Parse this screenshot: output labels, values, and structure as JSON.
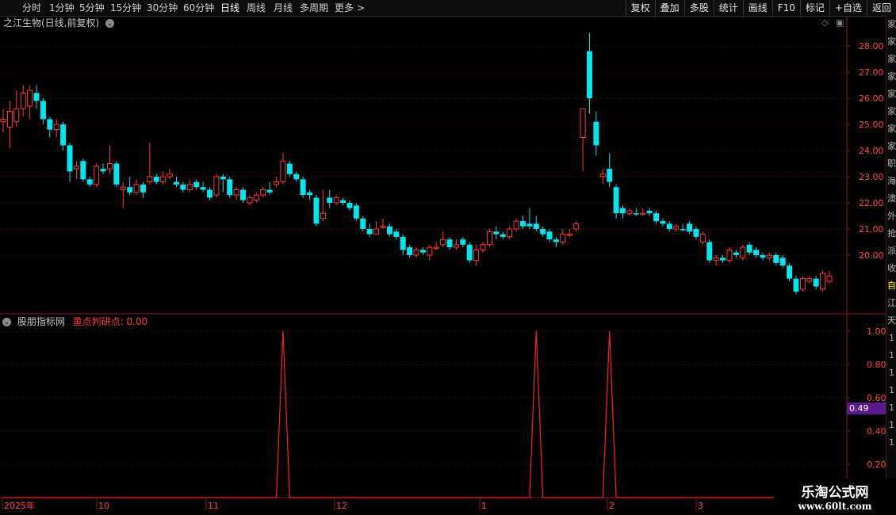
{
  "toolbar": {
    "periods": [
      "分时",
      "1分钟",
      "5分钟",
      "15分钟",
      "30分钟",
      "60分钟",
      "日线",
      "周线",
      "月线",
      "多周期",
      "更多"
    ],
    "active_period": "日线",
    "more_arrow": ">",
    "right_buttons": [
      "复权",
      "叠加",
      "多股",
      "统计",
      "画线",
      "F10",
      "标记",
      "+自选",
      "返回"
    ]
  },
  "main_chart": {
    "title": "之江生物(日线,前复权)",
    "price_axis_labels": [
      "28.00",
      "27.00",
      "26.00",
      "25.00",
      "24.00",
      "23.00",
      "22.00",
      "21.00",
      "20.00"
    ]
  },
  "indicator": {
    "name": "股朋指标网",
    "line_label": "重点判研点: 0.00",
    "axis_labels": [
      "1.00",
      "0.80",
      "0.60",
      "0.40",
      "0.20"
    ],
    "cursor_value": "0.49"
  },
  "date_axis": {
    "labels": [
      "2025年",
      "10",
      "11",
      "12",
      "1",
      "2",
      "3"
    ]
  },
  "right_strip": [
    "家",
    "家",
    "家",
    "家",
    "家",
    "家",
    "家",
    "家",
    "职",
    "海",
    "澳",
    "外",
    "抢",
    "派",
    "收",
    "自",
    "江",
    "天",
    "1",
    "1",
    "1",
    "1",
    "1",
    "1",
    "1"
  ],
  "watermark": {
    "line1": "乐淘公式网",
    "line2": "www.60lt.com"
  },
  "colors": {
    "up": "#ff3b3b",
    "down": "#00e5ee",
    "grid": "#5a1414",
    "axis_text": "#ff4a4a",
    "cursor_box": "#5a1a8a"
  },
  "chart_data": {
    "type": "candlestick",
    "price_range": [
      18.9,
      28.6
    ],
    "candles": [
      {
        "o": 25.1,
        "c": 25.2,
        "h": 25.6,
        "l": 24.7,
        "up": true
      },
      {
        "o": 24.9,
        "c": 25.5,
        "h": 25.9,
        "l": 24.1,
        "up": true
      },
      {
        "o": 25.1,
        "c": 25.6,
        "h": 26.3,
        "l": 24.9,
        "up": true
      },
      {
        "o": 25.6,
        "c": 26.2,
        "h": 26.5,
        "l": 25.3,
        "up": true
      },
      {
        "o": 25.7,
        "c": 26.3,
        "h": 26.5,
        "l": 25.2,
        "up": true
      },
      {
        "o": 26.2,
        "c": 25.9,
        "h": 26.5,
        "l": 25.6,
        "up": false
      },
      {
        "o": 25.9,
        "c": 25.2,
        "h": 26.0,
        "l": 25.0,
        "up": false
      },
      {
        "o": 25.2,
        "c": 24.8,
        "h": 25.3,
        "l": 24.5,
        "up": false
      },
      {
        "o": 24.8,
        "c": 25.0,
        "h": 25.2,
        "l": 24.5,
        "up": true
      },
      {
        "o": 25.0,
        "c": 24.2,
        "h": 25.1,
        "l": 24.0,
        "up": false
      },
      {
        "o": 24.2,
        "c": 23.2,
        "h": 24.3,
        "l": 22.8,
        "up": false
      },
      {
        "o": 23.3,
        "c": 23.4,
        "h": 23.6,
        "l": 22.9,
        "up": true
      },
      {
        "o": 23.6,
        "c": 22.9,
        "h": 23.7,
        "l": 22.8,
        "up": false
      },
      {
        "o": 22.9,
        "c": 22.7,
        "h": 23.0,
        "l": 22.6,
        "up": false
      },
      {
        "o": 22.7,
        "c": 23.4,
        "h": 23.5,
        "l": 22.6,
        "up": true
      },
      {
        "o": 23.3,
        "c": 23.2,
        "h": 23.5,
        "l": 23.1,
        "up": false
      },
      {
        "o": 23.3,
        "c": 23.5,
        "h": 24.2,
        "l": 23.1,
        "up": true
      },
      {
        "o": 23.5,
        "c": 22.7,
        "h": 23.6,
        "l": 22.6,
        "up": false
      },
      {
        "o": 22.5,
        "c": 22.6,
        "h": 22.8,
        "l": 21.8,
        "up": true
      },
      {
        "o": 22.6,
        "c": 22.4,
        "h": 23.0,
        "l": 22.3,
        "up": false
      },
      {
        "o": 22.4,
        "c": 22.7,
        "h": 22.9,
        "l": 22.3,
        "up": true
      },
      {
        "o": 22.7,
        "c": 22.4,
        "h": 22.8,
        "l": 22.2,
        "up": false
      },
      {
        "o": 22.8,
        "c": 23.0,
        "h": 24.3,
        "l": 22.7,
        "up": true
      },
      {
        "o": 23.0,
        "c": 22.8,
        "h": 23.1,
        "l": 22.7,
        "up": false
      },
      {
        "o": 22.8,
        "c": 23.0,
        "h": 23.2,
        "l": 22.7,
        "up": true
      },
      {
        "o": 23.0,
        "c": 23.1,
        "h": 23.3,
        "l": 22.9,
        "up": true
      },
      {
        "o": 22.8,
        "c": 22.7,
        "h": 23.0,
        "l": 22.6,
        "up": false
      },
      {
        "o": 22.7,
        "c": 22.5,
        "h": 22.8,
        "l": 22.4,
        "up": false
      },
      {
        "o": 22.5,
        "c": 22.7,
        "h": 22.9,
        "l": 22.4,
        "up": true
      },
      {
        "o": 22.8,
        "c": 22.6,
        "h": 22.9,
        "l": 22.5,
        "up": false
      },
      {
        "o": 22.6,
        "c": 22.5,
        "h": 22.8,
        "l": 22.4,
        "up": false
      },
      {
        "o": 22.5,
        "c": 22.2,
        "h": 22.6,
        "l": 22.1,
        "up": false
      },
      {
        "o": 22.3,
        "c": 23.0,
        "h": 23.1,
        "l": 22.2,
        "up": true
      },
      {
        "o": 23.0,
        "c": 22.9,
        "h": 23.1,
        "l": 22.4,
        "up": false
      },
      {
        "o": 22.9,
        "c": 22.3,
        "h": 23.0,
        "l": 22.2,
        "up": false
      },
      {
        "o": 22.3,
        "c": 22.5,
        "h": 22.6,
        "l": 22.1,
        "up": true
      },
      {
        "o": 22.5,
        "c": 22.1,
        "h": 22.6,
        "l": 22.0,
        "up": false
      },
      {
        "o": 22.0,
        "c": 22.2,
        "h": 22.3,
        "l": 21.9,
        "up": true
      },
      {
        "o": 22.1,
        "c": 22.3,
        "h": 22.4,
        "l": 22.0,
        "up": true
      },
      {
        "o": 22.3,
        "c": 22.5,
        "h": 22.6,
        "l": 22.2,
        "up": true
      },
      {
        "o": 22.5,
        "c": 22.4,
        "h": 22.8,
        "l": 22.3,
        "up": false
      },
      {
        "o": 22.7,
        "c": 22.8,
        "h": 23.0,
        "l": 22.6,
        "up": true
      },
      {
        "o": 22.8,
        "c": 23.6,
        "h": 23.9,
        "l": 22.7,
        "up": true
      },
      {
        "o": 23.5,
        "c": 23.1,
        "h": 23.6,
        "l": 23.0,
        "up": false
      },
      {
        "o": 23.1,
        "c": 22.9,
        "h": 23.2,
        "l": 22.8,
        "up": false
      },
      {
        "o": 22.9,
        "c": 22.3,
        "h": 23.0,
        "l": 22.2,
        "up": false
      },
      {
        "o": 22.4,
        "c": 22.3,
        "h": 22.5,
        "l": 22.1,
        "up": false
      },
      {
        "o": 22.2,
        "c": 21.2,
        "h": 22.3,
        "l": 21.1,
        "up": false
      },
      {
        "o": 21.4,
        "c": 21.6,
        "h": 22.5,
        "l": 21.3,
        "up": true
      },
      {
        "o": 22.2,
        "c": 22.0,
        "h": 22.5,
        "l": 21.8,
        "up": false
      },
      {
        "o": 22.0,
        "c": 22.2,
        "h": 22.3,
        "l": 21.9,
        "up": true
      },
      {
        "o": 22.1,
        "c": 22.0,
        "h": 22.2,
        "l": 21.9,
        "up": false
      },
      {
        "o": 22.0,
        "c": 21.8,
        "h": 22.1,
        "l": 21.7,
        "up": false
      },
      {
        "o": 21.9,
        "c": 21.4,
        "h": 22.0,
        "l": 21.3,
        "up": false
      },
      {
        "o": 21.4,
        "c": 21.0,
        "h": 21.5,
        "l": 20.9,
        "up": false
      },
      {
        "o": 21.0,
        "c": 20.8,
        "h": 21.2,
        "l": 20.7,
        "up": false
      },
      {
        "o": 20.8,
        "c": 21.0,
        "h": 21.3,
        "l": 20.8,
        "up": true
      },
      {
        "o": 21.1,
        "c": 21.1,
        "h": 21.4,
        "l": 21.0,
        "up": true
      },
      {
        "o": 21.1,
        "c": 20.8,
        "h": 21.2,
        "l": 20.7,
        "up": false
      },
      {
        "o": 20.9,
        "c": 20.7,
        "h": 21.0,
        "l": 20.6,
        "up": false
      },
      {
        "o": 20.7,
        "c": 20.2,
        "h": 20.8,
        "l": 20.0,
        "up": false
      },
      {
        "o": 20.3,
        "c": 20.0,
        "h": 20.4,
        "l": 19.9,
        "up": false
      },
      {
        "o": 20.0,
        "c": 20.2,
        "h": 20.3,
        "l": 19.9,
        "up": true
      },
      {
        "o": 20.2,
        "c": 20.1,
        "h": 20.3,
        "l": 20.0,
        "up": false
      },
      {
        "o": 20.0,
        "c": 20.3,
        "h": 20.4,
        "l": 19.8,
        "up": true
      },
      {
        "o": 20.3,
        "c": 20.3,
        "h": 20.5,
        "l": 20.2,
        "up": true
      },
      {
        "o": 20.4,
        "c": 20.6,
        "h": 20.9,
        "l": 20.3,
        "up": true
      },
      {
        "o": 20.6,
        "c": 20.3,
        "h": 20.7,
        "l": 20.2,
        "up": false
      },
      {
        "o": 20.3,
        "c": 20.4,
        "h": 20.6,
        "l": 20.2,
        "up": true
      },
      {
        "o": 20.6,
        "c": 20.4,
        "h": 20.7,
        "l": 20.3,
        "up": false
      },
      {
        "o": 20.4,
        "c": 19.8,
        "h": 20.5,
        "l": 19.7,
        "up": false
      },
      {
        "o": 19.8,
        "c": 20.2,
        "h": 20.4,
        "l": 19.6,
        "up": true
      },
      {
        "o": 20.2,
        "c": 20.4,
        "h": 20.5,
        "l": 20.1,
        "up": true
      },
      {
        "o": 20.4,
        "c": 20.9,
        "h": 21.0,
        "l": 20.3,
        "up": true
      },
      {
        "o": 20.9,
        "c": 20.8,
        "h": 21.1,
        "l": 20.6,
        "up": false
      },
      {
        "o": 20.8,
        "c": 20.7,
        "h": 20.9,
        "l": 20.6,
        "up": false
      },
      {
        "o": 20.7,
        "c": 21.0,
        "h": 21.1,
        "l": 20.6,
        "up": true
      },
      {
        "o": 21.0,
        "c": 21.3,
        "h": 21.4,
        "l": 20.9,
        "up": true
      },
      {
        "o": 21.3,
        "c": 21.1,
        "h": 21.5,
        "l": 21.0,
        "up": false
      },
      {
        "o": 21.2,
        "c": 21.1,
        "h": 21.8,
        "l": 21.0,
        "up": false
      },
      {
        "o": 21.2,
        "c": 21.0,
        "h": 21.5,
        "l": 20.9,
        "up": false
      },
      {
        "o": 21.0,
        "c": 20.8,
        "h": 21.1,
        "l": 20.7,
        "up": false
      },
      {
        "o": 20.9,
        "c": 20.6,
        "h": 21.0,
        "l": 20.5,
        "up": false
      },
      {
        "o": 20.6,
        "c": 20.5,
        "h": 20.7,
        "l": 20.3,
        "up": false
      },
      {
        "o": 20.5,
        "c": 20.8,
        "h": 21.0,
        "l": 20.4,
        "up": true
      },
      {
        "o": 20.8,
        "c": 20.8,
        "h": 21.0,
        "l": 20.7,
        "up": true
      },
      {
        "o": 21.0,
        "c": 21.2,
        "h": 21.3,
        "l": 20.9,
        "up": true
      },
      {
        "o": 25.6,
        "c": 24.5,
        "h": 25.6,
        "l": 23.2,
        "up": true
      },
      {
        "o": 26.0,
        "c": 27.8,
        "h": 28.5,
        "l": 25.4,
        "up": false
      },
      {
        "o": 25.1,
        "c": 24.2,
        "h": 25.5,
        "l": 23.8,
        "up": false
      },
      {
        "o": 23.0,
        "c": 23.1,
        "h": 23.3,
        "l": 22.7,
        "up": true
      },
      {
        "o": 23.3,
        "c": 22.8,
        "h": 23.9,
        "l": 22.6,
        "up": false
      },
      {
        "o": 22.6,
        "c": 21.6,
        "h": 22.7,
        "l": 21.4,
        "up": false
      },
      {
        "o": 21.8,
        "c": 21.6,
        "h": 21.9,
        "l": 21.4,
        "up": false
      },
      {
        "o": 21.6,
        "c": 21.7,
        "h": 21.8,
        "l": 21.5,
        "up": true
      },
      {
        "o": 21.6,
        "c": 21.6,
        "h": 21.8,
        "l": 21.5,
        "up": false
      },
      {
        "o": 21.6,
        "c": 21.6,
        "h": 21.8,
        "l": 21.5,
        "up": true
      },
      {
        "o": 21.7,
        "c": 21.6,
        "h": 21.8,
        "l": 21.5,
        "up": false
      },
      {
        "o": 21.6,
        "c": 21.3,
        "h": 21.7,
        "l": 21.2,
        "up": false
      },
      {
        "o": 21.3,
        "c": 21.2,
        "h": 21.4,
        "l": 21.1,
        "up": false
      },
      {
        "o": 21.2,
        "c": 21.0,
        "h": 21.3,
        "l": 20.9,
        "up": false
      },
      {
        "o": 21.0,
        "c": 21.1,
        "h": 21.2,
        "l": 20.9,
        "up": true
      },
      {
        "o": 21.0,
        "c": 21.0,
        "h": 21.2,
        "l": 20.9,
        "up": false
      },
      {
        "o": 21.2,
        "c": 20.9,
        "h": 21.3,
        "l": 20.8,
        "up": false
      },
      {
        "o": 21.0,
        "c": 20.7,
        "h": 21.1,
        "l": 20.6,
        "up": false
      },
      {
        "o": 20.8,
        "c": 20.5,
        "h": 20.9,
        "l": 20.4,
        "up": true
      },
      {
        "o": 20.5,
        "c": 19.8,
        "h": 20.6,
        "l": 19.7,
        "up": false
      },
      {
        "o": 19.8,
        "c": 19.9,
        "h": 20.0,
        "l": 19.6,
        "up": true
      },
      {
        "o": 19.9,
        "c": 19.8,
        "h": 20.0,
        "l": 19.7,
        "up": false
      },
      {
        "o": 19.8,
        "c": 20.2,
        "h": 20.3,
        "l": 19.7,
        "up": true
      },
      {
        "o": 20.1,
        "c": 20.0,
        "h": 20.2,
        "l": 19.9,
        "up": false
      },
      {
        "o": 19.9,
        "c": 20.3,
        "h": 20.4,
        "l": 19.8,
        "up": true
      },
      {
        "o": 20.4,
        "c": 20.1,
        "h": 20.5,
        "l": 20.0,
        "up": false
      },
      {
        "o": 20.2,
        "c": 20.0,
        "h": 20.3,
        "l": 19.9,
        "up": false
      },
      {
        "o": 20.0,
        "c": 19.9,
        "h": 20.1,
        "l": 19.8,
        "up": false
      },
      {
        "o": 19.9,
        "c": 20.0,
        "h": 20.1,
        "l": 19.8,
        "up": true
      },
      {
        "o": 20.0,
        "c": 19.7,
        "h": 20.1,
        "l": 19.6,
        "up": false
      },
      {
        "o": 19.9,
        "c": 19.6,
        "h": 20.0,
        "l": 19.5,
        "up": false
      },
      {
        "o": 19.6,
        "c": 19.1,
        "h": 19.7,
        "l": 19.0,
        "up": false
      },
      {
        "o": 19.1,
        "c": 18.6,
        "h": 19.2,
        "l": 18.5,
        "up": false
      },
      {
        "o": 18.7,
        "c": 19.1,
        "h": 19.2,
        "l": 18.6,
        "up": true
      },
      {
        "o": 19.0,
        "c": 19.1,
        "h": 19.2,
        "l": 18.9,
        "up": true
      },
      {
        "o": 19.1,
        "c": 18.8,
        "h": 19.2,
        "l": 18.7,
        "up": false
      },
      {
        "o": 18.7,
        "c": 19.3,
        "h": 19.4,
        "l": 18.6,
        "up": true
      },
      {
        "o": 19.2,
        "c": 19.0,
        "h": 19.4,
        "l": 18.9,
        "up": true
      }
    ],
    "indicator_spikes": [
      {
        "candle_index": 42,
        "value": 1.0
      },
      {
        "candle_index": 80,
        "value": 1.0
      },
      {
        "candle_index": 91,
        "value": 1.0
      }
    ],
    "indicator_range": [
      0,
      1.05
    ]
  }
}
